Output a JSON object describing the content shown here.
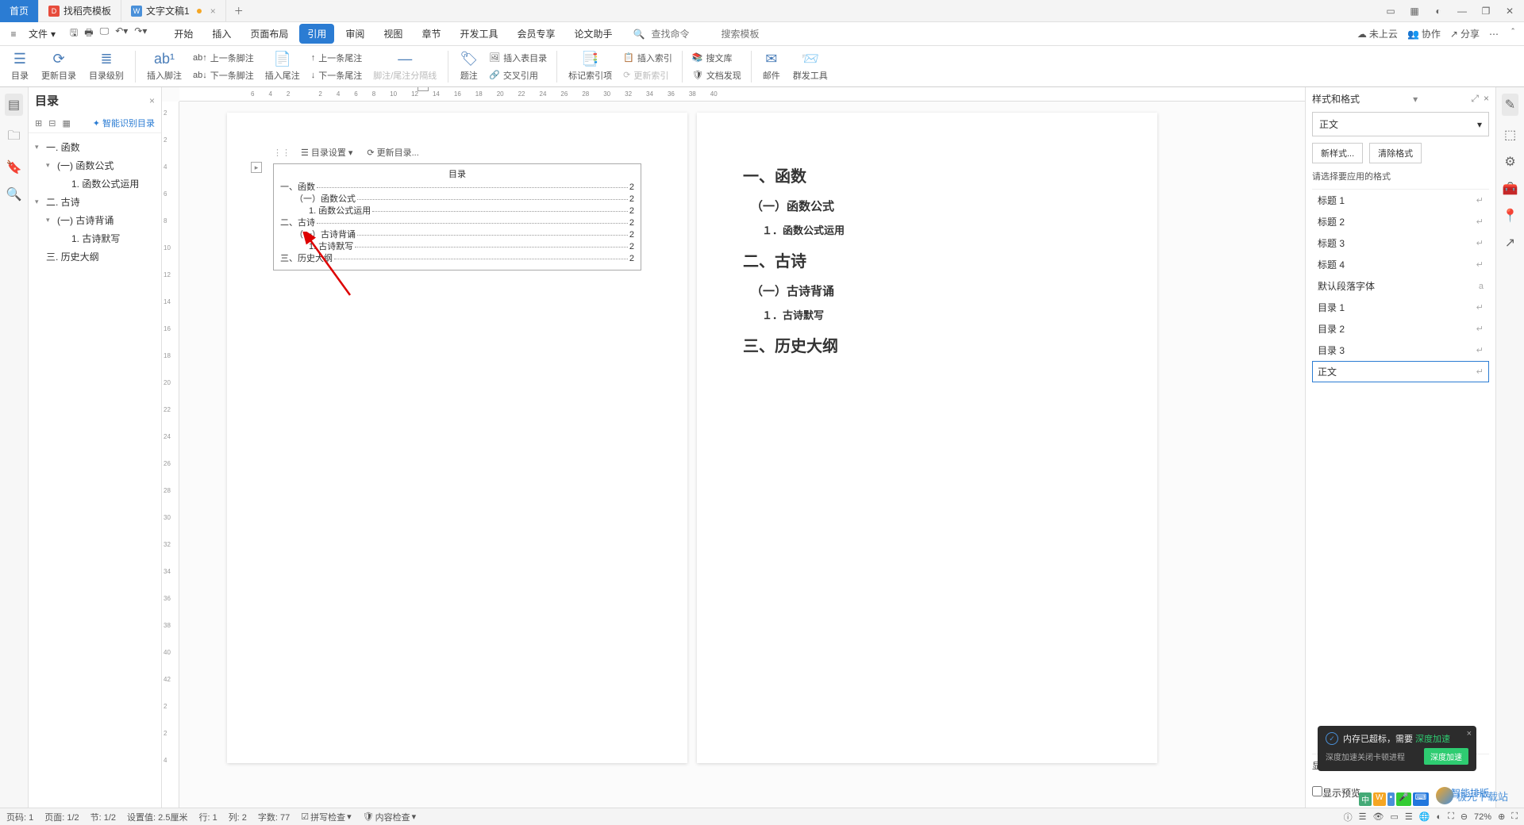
{
  "titlebar": {
    "tabs": [
      {
        "label": "首页",
        "type": "home"
      },
      {
        "label": "找稻壳模板",
        "icon": "red"
      },
      {
        "label": "文字文稿1",
        "icon": "blue",
        "modified": true
      }
    ]
  },
  "menubar": {
    "file": "文件",
    "tabs": [
      "开始",
      "插入",
      "页面布局",
      "引用",
      "审阅",
      "视图",
      "章节",
      "开发工具",
      "会员专享",
      "论文助手"
    ],
    "active": "引用",
    "search_cmd": "查找命令",
    "search_tpl": "搜索模板",
    "cloud": "未上云",
    "coop": "协作",
    "share": "分享"
  },
  "ribbon": {
    "toc": "目录",
    "update_toc": "更新目录",
    "toc_level": "目录级别",
    "insert_footnote": "插入脚注",
    "ab_prev": "上一条脚注",
    "ab_next": "下一条脚注",
    "insert_endnote": "插入尾注",
    "prev_endnote": "上一条尾注",
    "next_endnote": "下一条尾注",
    "fn_sep": "脚注/尾注分隔线",
    "caption": "题注",
    "cross_ref": "交叉引用",
    "insert_fig_toc": "插入表目录",
    "mark_index": "标记索引项",
    "update_index": "更新索引",
    "insert_index": "插入索引",
    "search_lib": "搜文库",
    "doc_discover": "文档发现",
    "mail": "邮件",
    "mass_tool": "群发工具"
  },
  "outline": {
    "title": "目录",
    "smart": "智能识别目录",
    "items": [
      {
        "level": 1,
        "label": "一. 函数",
        "expand": true
      },
      {
        "level": 2,
        "label": "(一) 函数公式",
        "expand": true
      },
      {
        "level": 3,
        "label": "1. 函数公式运用"
      },
      {
        "level": 1,
        "label": "二. 古诗",
        "expand": true
      },
      {
        "level": 2,
        "label": "(一) 古诗背诵",
        "expand": true
      },
      {
        "level": 3,
        "label": "1. 古诗默写"
      },
      {
        "level": 1,
        "label": "三. 历史大纲"
      }
    ]
  },
  "toc_popup": {
    "settings": "目录设置",
    "update": "更新目录..."
  },
  "page1": {
    "toc_title": "目录",
    "rows": [
      {
        "indent": 0,
        "label": "一、函数",
        "page": "2"
      },
      {
        "indent": 1,
        "label": "（一）函数公式",
        "page": "2"
      },
      {
        "indent": 2,
        "label": "1. 函数公式运用",
        "page": "2"
      },
      {
        "indent": 0,
        "label": "二、古诗",
        "page": "2"
      },
      {
        "indent": 1,
        "label": "（一）古诗背诵",
        "page": "2"
      },
      {
        "indent": 2,
        "label": "1. 古诗默写",
        "page": "2"
      },
      {
        "indent": 0,
        "label": "三、历史大纲",
        "page": "2"
      }
    ]
  },
  "page2": {
    "h": [
      {
        "tag": "h1",
        "text": "一、函数"
      },
      {
        "tag": "h2",
        "text": "（一）函数公式"
      },
      {
        "tag": "h3",
        "text": "１．函数公式运用"
      },
      {
        "tag": "h1",
        "text": "二、古诗"
      },
      {
        "tag": "h2",
        "text": "（一）古诗背诵"
      },
      {
        "tag": "h3",
        "text": "１．古诗默写"
      },
      {
        "tag": "h1",
        "text": "三、历史大纲"
      }
    ]
  },
  "styles": {
    "title": "样式和格式",
    "current": "正文",
    "new": "新样式...",
    "clear": "清除格式",
    "choose": "请选择要应用的格式",
    "show_label": "显示",
    "preview": "显示预览",
    "smart": "智能排版",
    "list": [
      {
        "name": "标题 1",
        "ret": "↵"
      },
      {
        "name": "标题 2",
        "ret": "↵"
      },
      {
        "name": "标题 3",
        "ret": "↵"
      },
      {
        "name": "标题 4",
        "ret": "↵"
      },
      {
        "name": "默认段落字体",
        "ret": "a"
      },
      {
        "name": "目录 1",
        "ret": "↵"
      },
      {
        "name": "目录 2",
        "ret": "↵"
      },
      {
        "name": "目录 3",
        "ret": "↵"
      },
      {
        "name": "正文",
        "ret": "↵",
        "selected": true
      }
    ]
  },
  "status": {
    "page_no": "页码: 1",
    "page": "页面: 1/2",
    "section": "节: 1/2",
    "pos": "设置值: 2.5厘米",
    "line": "行: 1",
    "col": "列: 2",
    "words": "字数: 77",
    "spell": "拼写检查",
    "content": "内容检查",
    "zoom": "72%"
  },
  "toast": {
    "msg1": "内存已超标，需要",
    "hl": "深度加速",
    "msg2": "深度加速关闭卡顿进程",
    "btn": "深度加速"
  },
  "watermark": "极光下载站",
  "ruler_h": [
    "6",
    "4",
    "2",
    "",
    "2",
    "4",
    "6",
    "8",
    "10",
    "12",
    "14",
    "16",
    "18",
    "20",
    "22",
    "24",
    "26",
    "28",
    "30",
    "32",
    "34",
    "36",
    "38",
    "40"
  ],
  "ruler_v": [
    "2",
    "2",
    "4",
    "6",
    "8",
    "10",
    "12",
    "14",
    "16",
    "18",
    "20",
    "22",
    "24",
    "26",
    "28",
    "30",
    "32",
    "34",
    "36",
    "38",
    "40",
    "42",
    "2",
    "2",
    "4"
  ]
}
